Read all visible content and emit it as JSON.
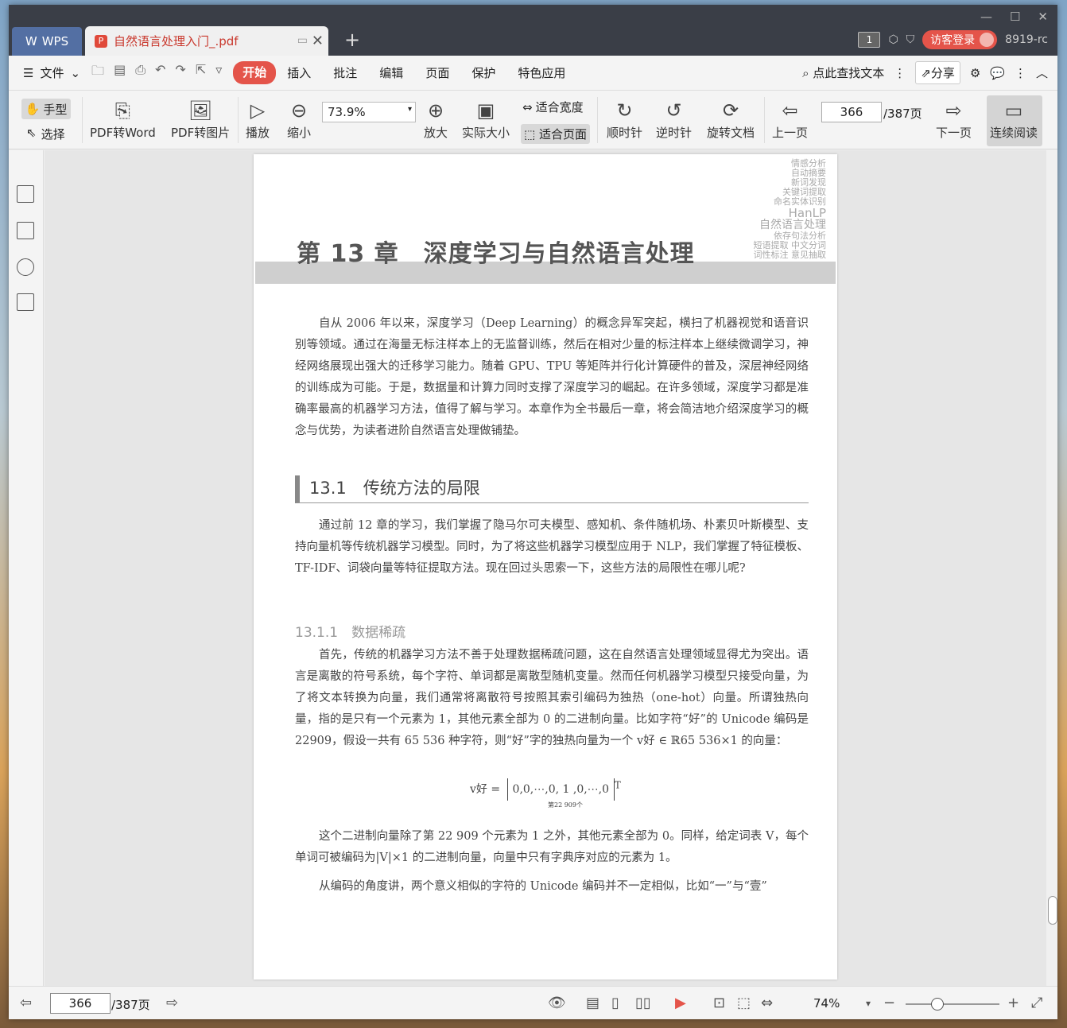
{
  "app": {
    "brand": "WPS",
    "doc_tab": "自然语言处理入门_.pdf",
    "badge": "1",
    "login": "访客登录",
    "user_id": "8919-rc"
  },
  "menu": {
    "file": "文件",
    "tabs": [
      "开始",
      "插入",
      "批注",
      "编辑",
      "页面",
      "保护",
      "特色应用"
    ],
    "search": "点此查找文本",
    "share": "分享"
  },
  "toolbar": {
    "hand": "手型",
    "select": "选择",
    "pdf_word": "PDF转Word",
    "pdf_img": "PDF转图片",
    "play": "播放",
    "zoom_out": "缩小",
    "zoom_value": "73.9%",
    "zoom_in": "放大",
    "actual": "实际大小",
    "fit_width": "适合宽度",
    "fit_page": "适合页面",
    "cw": "顺时针",
    "ccw": "逆时针",
    "rotate": "旋转文档",
    "prev": "上一页",
    "page": "366",
    "total": "/387页",
    "next": "下一页",
    "continuous": "连续阅读"
  },
  "doc": {
    "chapter": "第 13 章　深度学习与自然语言处理",
    "cloud": [
      "情感分析",
      "自动摘要",
      "新词发现",
      "关键词提取",
      "命名实体识别",
      "HanLP",
      "自然语言处理",
      "依存句法分析",
      "短语提取 中文分词",
      "词性标注 意见抽取"
    ],
    "p1": "自从 2006 年以来，深度学习（Deep Learning）的概念异军突起，横扫了机器视觉和语音识别等领域。通过在海量无标注样本上的无监督训练，然后在相对少量的标注样本上继续微调学习，神经网络展现出强大的迁移学习能力。随着 GPU、TPU 等矩阵并行化计算硬件的普及，深层神经网络的训练成为可能。于是，数据量和计算力同时支撑了深度学习的崛起。在许多领域，深度学习都是准确率最高的机器学习方法，值得了解与学习。本章作为全书最后一章，将会简洁地介绍深度学习的概念与优势，为读者进阶自然语言处理做铺垫。",
    "sec": "13.1　传统方法的局限",
    "p2": "通过前 12 章的学习，我们掌握了隐马尔可夫模型、感知机、条件随机场、朴素贝叶斯模型、支持向量机等传统机器学习模型。同时，为了将这些机器学习模型应用于 NLP，我们掌握了特征模板、TF-IDF、词袋向量等特征提取方法。现在回过头思索一下，这些方法的局限性在哪儿呢?",
    "subsec": "13.1.1　数据稀疏",
    "p3": "首先，传统的机器学习方法不善于处理数据稀疏问题，这在自然语言处理领域显得尤为突出。语言是离散的符号系统，每个字符、单词都是离散型随机变量。然而任何机器学习模型只接受向量，为了将文本转换为向量，我们通常将离散符号按照其索引编码为独热（one-hot）向量。所谓独热向量，指的是只有一个元素为 1，其他元素全部为 0 的二进制向量。比如字符“好”的 Unicode 编码是 22909，假设一共有 65 536 种字符，则“好”字的独热向量为一个 v好 ∈ ℝ65 536×1 的向量：",
    "formula_lhs": "v好 =",
    "formula_body": "0,0,⋯,0,  1  ,0,⋯,0",
    "formula_sup": "T",
    "formula_under": "第22 909个",
    "p4": "这个二进制向量除了第 22 909 个元素为 1 之外，其他元素全部为 0。同样，给定词表 V，每个单词可被编码为|V|×1 的二进制向量，向量中只有字典序对应的元素为 1。",
    "p5": "从编码的角度讲，两个意义相似的字符的 Unicode 编码并不一定相似，比如“一”与“壹”"
  },
  "status": {
    "page": "366",
    "total": "/387页",
    "zoom": "74%"
  },
  "colors": {
    "accent": "#e4544a",
    "titlebar": "#3a3e47",
    "tab_wps": "#536fa3"
  }
}
